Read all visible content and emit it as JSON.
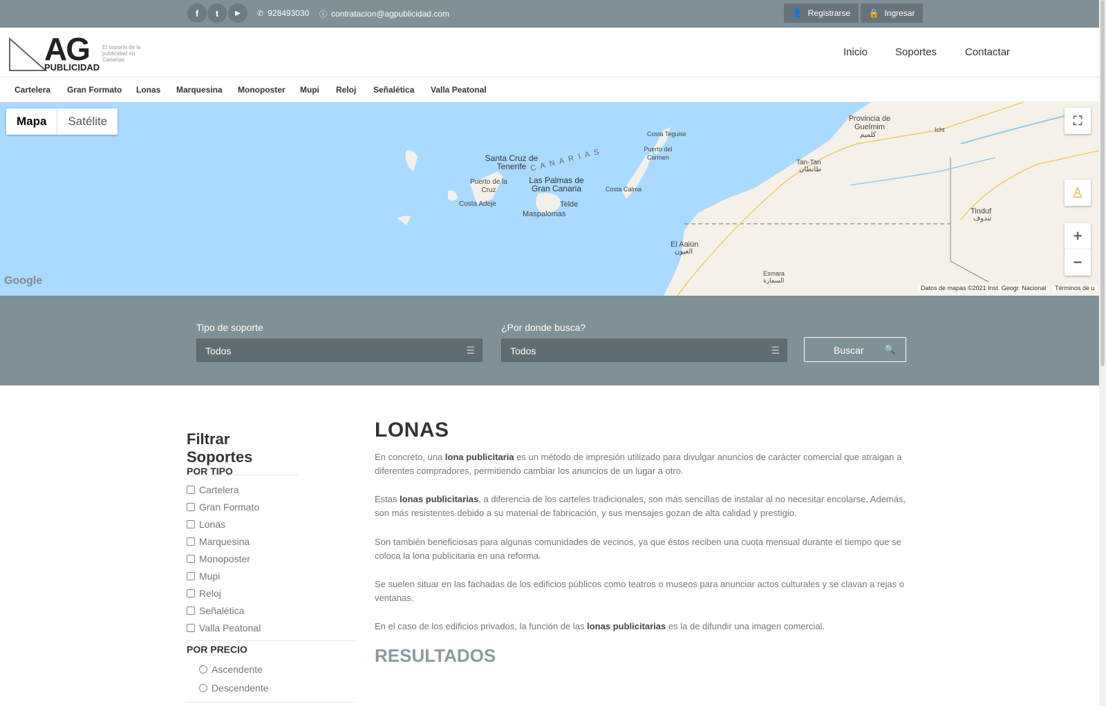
{
  "topbar": {
    "social": [
      {
        "name": "facebook-icon",
        "glyph": "f"
      },
      {
        "name": "twitter-icon",
        "glyph": "t"
      },
      {
        "name": "youtube-icon",
        "glyph": "▶"
      }
    ],
    "phone": "928493030",
    "email": "contratacion@agpublicidad.com",
    "register_label": "Registrarse",
    "login_label": "Ingresar"
  },
  "header": {
    "logo_main": "AG",
    "logo_sub": "PUBLICIDAD",
    "logo_tagline": "El soporte de la publicidad en Canarias",
    "nav": [
      "Inicio",
      "Soportes",
      "Contactar"
    ]
  },
  "categories": [
    "Cartelera",
    "Gran Formato",
    "Lonas",
    "Marquesina",
    "Monoposter",
    "Mupi",
    "Reloj",
    "Señalética",
    "Valla Peatonal"
  ],
  "map": {
    "type_map": "Mapa",
    "type_satellite": "Satélite",
    "labels": {
      "santa_cruz": "Santa Cruz de Tenerife",
      "canarias": "C A N A R I A S",
      "puerto_cruz": "Puerto de la Cruz",
      "costa_adeje": "Costa Adeje",
      "las_palmas": "Las Palmas de Gran Canaria",
      "telde": "Telde",
      "maspalomas": "Maspalomas",
      "costa_teguise": "Costa Teguise",
      "puerto_carmen": "Puerto del Carmen",
      "costa_calma": "Costa Calma",
      "guelmim": "Provincia de Guelmim",
      "guelmim_ar": "كلميم",
      "icht": "Icht",
      "tan_tan": "Tan-Tan",
      "tan_tan_ar": "طانطان",
      "tinduf": "Tinduf",
      "tinduf_ar": "تندوف",
      "el_aaiun": "El Aaiún",
      "el_aaiun_ar": "العيون",
      "esmara": "Esmara",
      "esmara_ar": "السمارة"
    },
    "google": "Google",
    "attribution": "Datos de mapas ©2021 Inst. Geogr. Nacional",
    "terms": "Términos de u"
  },
  "search": {
    "type_label": "Tipo de soporte",
    "type_value": "Todos",
    "where_label": "¿Por donde busca?",
    "where_value": "Todos",
    "button_label": "Buscar"
  },
  "filters": {
    "title": "Filtrar Soportes",
    "by_type": "POR TIPO",
    "types": [
      "Cartelera",
      "Gran Formato",
      "Lonas",
      "Marquesina",
      "Monoposter",
      "Mupi",
      "Reloj",
      "Señalética",
      "Valla Peatonal"
    ],
    "by_price": "POR PRECIO",
    "prices": [
      "Ascendente",
      "Descendente"
    ]
  },
  "content": {
    "title": "LONAS",
    "p1_a": "En concreto, una ",
    "p1_b": "lona publicitaria",
    "p1_c": " es un método de impresión utilizado para divulgar anuncios de carácter comercial que atraigan a diferentes compradores, permitiendo cambiar los anuncios de un lugar a otro.",
    "p2_a": "Estas ",
    "p2_b": "lonas publicitarias",
    "p2_c": ", a diferencia de los carteles tradicionales, son más sencillas de instalar al no necesitar encolarse. Además, son más resistentes debido a su material de fabricación, y sus mensajes gozan de alta calidad y prestigio.",
    "p3": "Son también beneficiosas para algunas comunidades de vecinos, ya que éstos reciben una cuota mensual durante el tiempo que se coloca la lona publicitaria en una reforma.",
    "p4": "Se suelen situar en las fachadas de los edificios públicos como teatros o museos para anunciar actos culturales y se clavan a rejas o ventanas.",
    "p5_a": "En el caso de los edificios privados, la función de las ",
    "p5_b": "lonas publicitarias",
    "p5_c": " es la de difundir una imagen comercial.",
    "results": "RESULTADOS"
  }
}
